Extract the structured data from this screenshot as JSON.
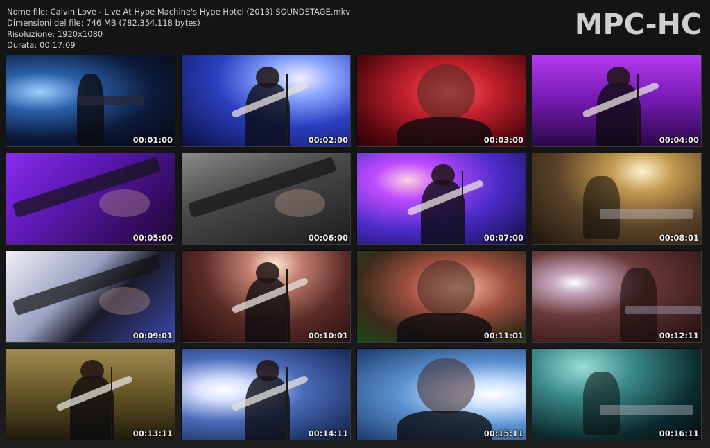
{
  "header": {
    "file_name_line": "Nome file: Calvin Love - Live At Hype Machine's Hype Hotel (2013) SOUNDSTAGE.mkv",
    "size_line": "Dimensioni del file: 746 MB (782.354.118 bytes)",
    "resolution_line": "Risoluzione: 1920x1080",
    "duration_line": "Durata: 00:17:09"
  },
  "logo": {
    "text": "MPC-HC"
  },
  "thumbnails": [
    {
      "time": "00:01:00",
      "bg": "radial-gradient(ellipse at 20% 40%, #9fd0ff 0%, #2a5fa8 25%, #0c1a3a 60%, #04070f 100%)",
      "fig": "silhouette-left"
    },
    {
      "time": "00:02:00",
      "bg": "radial-gradient(ellipse at 70% 25%, #f4f0ff 0%, #8aa4ff 20%, #2a3fc0 50%, #0a0f40 100%)",
      "fig": "guitarist"
    },
    {
      "time": "00:03:00",
      "bg": "radial-gradient(ellipse at 55% 40%, #ff5a5a 0%, #c0202c 35%, #5a0810 75%, #2a0206 100%)",
      "fig": "face"
    },
    {
      "time": "00:04:00",
      "bg": "linear-gradient(180deg, #b33cf0 0%, #7a1cb8 45%, #2a0848 100%)",
      "fig": "guitarist"
    },
    {
      "time": "00:05:00",
      "bg": "linear-gradient(135deg, #8a2cf0 0%, #5a18b0 40%, #1e0630 100%)",
      "fig": "closeup"
    },
    {
      "time": "00:06:00",
      "bg": "linear-gradient(160deg, #8a8a8a 0%, #4a4a4a 40%, #1c1c1c 100%)",
      "fig": "closeup"
    },
    {
      "time": "00:07:00",
      "bg": "radial-gradient(ellipse at 30% 30%, #ffd0e0 0%, #c04cff 20%, #4a2cc8 55%, #120c40 100%)",
      "fig": "guitarist"
    },
    {
      "time": "00:08:01",
      "bg": "radial-gradient(ellipse at 65% 20%, #fff4d0 0%, #c49a50 20%, #5a4228 55%, #1e150c 100%)",
      "fig": "keys"
    },
    {
      "time": "00:09:01",
      "bg": "linear-gradient(135deg, #f0f0f8 0%, #9aa0c0 40%, #1a1a2a 60%, #3a48a8 100%)",
      "fig": "closeup"
    },
    {
      "time": "00:10:01",
      "bg": "radial-gradient(ellipse at 55% 15%, #ffe8d8 0%, #c48070 20%, #5a2a26 55%, #1e0c0c 100%)",
      "fig": "guitarist"
    },
    {
      "time": "00:11:01",
      "bg": "radial-gradient(ellipse at 60% 40%, #f6c0a0 0%, #a05040 35%, #3a2a1a 70%, #1a4a1a 100%)",
      "fig": "face"
    },
    {
      "time": "00:12:11",
      "bg": "radial-gradient(ellipse at 25% 35%, #ffffff 0%, #c8a8c0 12%, #6a3a3a 40%, #200c0c 100%)",
      "fig": "silhouette-right"
    },
    {
      "time": "00:13:11",
      "bg": "linear-gradient(180deg, #a08a50 0%, #6a5a2a 45%, #201a0a 100%)",
      "fig": "guitarist"
    },
    {
      "time": "00:14:11",
      "bg": "radial-gradient(ellipse at 25% 45%, #ffffff 0%, #d8e0ff 15%, #4a6ab8 45%, #0c1a40 100%)",
      "fig": "guitarist"
    },
    {
      "time": "00:15:11",
      "bg": "radial-gradient(ellipse at 80% 50%, #ffffff 0%, #c8e0ff 20%, #5a90d0 50%, #1a3a6a 100%)",
      "fig": "face"
    },
    {
      "time": "00:16:11",
      "bg": "radial-gradient(ellipse at 30% 20%, #9adcd8 0%, #3a8a8a 30%, #0c2a2e 70%, #050c0e 100%)",
      "fig": "keys"
    }
  ],
  "colors": {
    "background": "#161616",
    "header_text": "#d2d2d2",
    "logo": "#cfcfcf"
  }
}
